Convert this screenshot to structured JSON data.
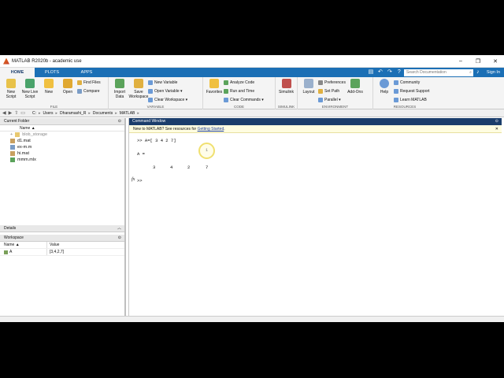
{
  "window": {
    "title": "MATLAB R2020b - academic use",
    "min": "–",
    "max": "❐",
    "close": "✕"
  },
  "tabs": [
    {
      "label": "HOME"
    },
    {
      "label": "PLOTS"
    },
    {
      "label": "APPS"
    }
  ],
  "search": {
    "placeholder": "Search Documentation",
    "signin": "Sign In"
  },
  "ribbon": {
    "file": {
      "label": "FILE",
      "new_script": "New Script",
      "new_live": "New Live Script",
      "new": "New",
      "open": "Open",
      "find_files": "Find Files",
      "compare": "Compare"
    },
    "variable": {
      "label": "VARIABLE",
      "import": "Import Data",
      "save_ws": "Save Workspace",
      "new_var": "New Variable",
      "open_var": "Open Variable ▾",
      "clear_ws": "Clear Workspace ▾"
    },
    "code": {
      "label": "CODE",
      "favorites": "Favorites",
      "analyze": "Analyze Code",
      "run_time": "Run and Time",
      "clear_cmds": "Clear Commands ▾"
    },
    "simulink": {
      "label": "SIMULINK",
      "simulink": "Simulink"
    },
    "environment": {
      "label": "ENVIRONMENT",
      "layout": "Layout",
      "prefs": "Preferences",
      "set_path": "Set Path",
      "parallel": "Parallel ▾",
      "addons": "Add-Ons"
    },
    "resources": {
      "label": "RESOURCES",
      "help": "Help",
      "community": "Community",
      "request": "Request Support",
      "learn": "Learn MATLAB"
    }
  },
  "path": [
    "C:",
    "Users",
    "Dharamashi_R",
    "Documents",
    "MATLAB"
  ],
  "current_folder": {
    "title": "Current Folder",
    "col_name": "Name ▲",
    "files": [
      "blob_storage",
      "d1.mat",
      "ex-m.m",
      "hi.mat",
      "mmm.mlx"
    ]
  },
  "details": {
    "title": "Details"
  },
  "workspace": {
    "title": "Workspace",
    "col_name": "Name ▲",
    "col_value": "Value",
    "rows": [
      {
        "name": "A",
        "value": "[3,4,2,7]"
      }
    ]
  },
  "command_window": {
    "title": "Command Window",
    "notice_prefix": "New to MATLAB? See resources for ",
    "notice_link": "Getting Started",
    "notice_suffix": ".",
    "input_line": ">> A=[ 3 4 2 7]",
    "output_var": "A =",
    "output_values": [
      "3",
      "4",
      "2",
      "7"
    ],
    "prompt": ">>",
    "fx": "fx",
    "click_marker": "1"
  }
}
